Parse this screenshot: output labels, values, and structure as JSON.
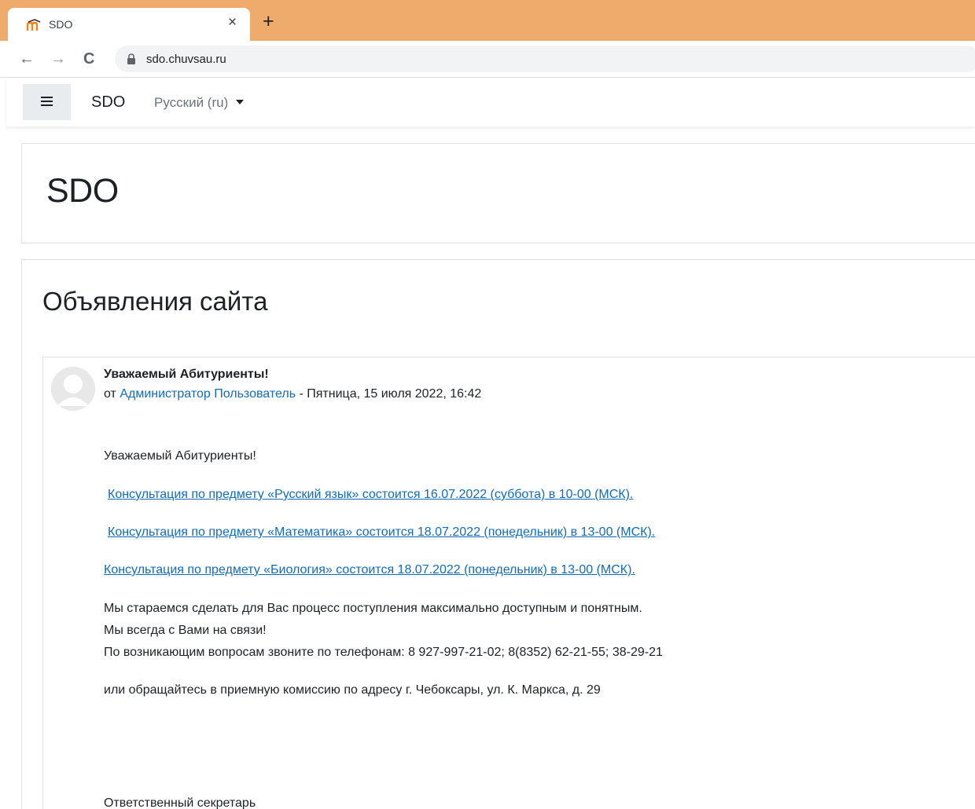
{
  "browser": {
    "tab_title": "SDO",
    "tab_close": "×",
    "new_tab": "+",
    "url": "sdo.chuvsau.ru",
    "back": "←",
    "forward": "→",
    "reload": "C"
  },
  "navbar": {
    "brand": "SDO",
    "language": "Русский ‎(ru)‎"
  },
  "page": {
    "title": "SDO"
  },
  "announcements": {
    "heading": "Объявления сайта",
    "post": {
      "subject": "Уважаемый Абитуриенты!",
      "by_prefix": "от ",
      "author": "Администратор Пользователь",
      "date": " - Пятница, 15 июля 2022, 16:42",
      "greeting": "Уважаемый Абитуриенты!",
      "link_1": "Консультация по предмету «Русский язык» состоится 16.07.2022 (суббота)  в 10-00 (МСК).",
      "link_2": "Консультация по предмету «Математика» состоится 18.07.2022 (понедельник)  в 13-00 (МСК).",
      "link_3": "Консультация по предмету «Биология» состоится 18.07.2022 (понедельник)  в 13-00 (МСК).",
      "line_1": "Мы стараемся сделать для Вас процесс поступления максимально доступным и понятным.",
      "line_2": "Мы всегда с Вами на связи!",
      "line_3": "По возникающим вопросам звоните по телефонам: 8 927-997-21-02; 8(8352) 62-21-55; 38-29-21",
      "line_4": "или обращайтесь в приемную комиссию по адресу г. Чебоксары, ул. К. Маркса, д. 29",
      "signature": "Ответственный секретарь"
    }
  },
  "colors": {
    "tabstrip": "#efab6b",
    "link": "#0f6cbf",
    "text": "#1d2125"
  }
}
